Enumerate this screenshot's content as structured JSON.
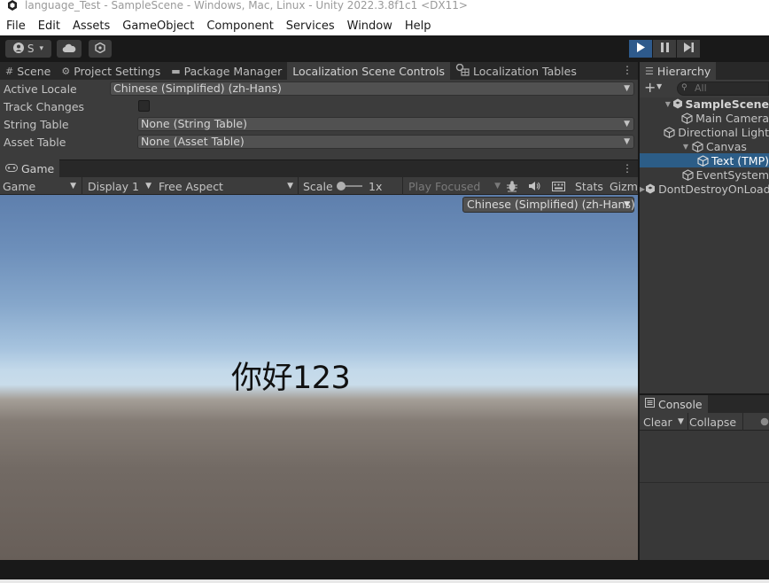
{
  "titlebar": {
    "title": "language_Test - SampleScene - Windows, Mac, Linux - Unity 2022.3.8f1c1 <DX11>"
  },
  "menubar": {
    "items": [
      "File",
      "Edit",
      "Assets",
      "GameObject",
      "Component",
      "Services",
      "Window",
      "Help"
    ]
  },
  "toolbar": {
    "account_label": "S",
    "account_caret": "▾"
  },
  "scene_panel": {
    "tabs": [
      {
        "label": "Scene",
        "icon": "grid-icon"
      },
      {
        "label": "Project Settings",
        "icon": "gear-icon"
      },
      {
        "label": "Package Manager",
        "icon": "package-icon"
      },
      {
        "label": "Localization Scene Controls",
        "icon": ""
      },
      {
        "label": "Localization Tables",
        "icon": "localization-table-icon"
      }
    ],
    "active_locale_label": "Active Locale",
    "active_locale_value": "Chinese (Simplified) (zh-Hans)",
    "track_changes_label": "Track Changes",
    "string_table_label": "String Table",
    "string_table_value": "None (String Table)",
    "asset_table_label": "Asset Table",
    "asset_table_value": "None (Asset Table)"
  },
  "game_panel": {
    "tab_label": "Game",
    "display_mode": "Game",
    "display": "Display 1",
    "aspect": "Free Aspect",
    "scale_label": "Scale",
    "scale_value": "1x",
    "play_focused": "Play Focused",
    "stats_label": "Stats",
    "gizmos_label": "Gizmos",
    "locale_popup": "Chinese (Simplified) (zh-Hans)",
    "scene_text": "你好123"
  },
  "hierarchy": {
    "tab_label": "Hierarchy",
    "search_placeholder": "All",
    "items": [
      {
        "label": "SampleScene"
      },
      {
        "label": "Main Camera"
      },
      {
        "label": "Directional Light"
      },
      {
        "label": "Canvas"
      },
      {
        "label": "Text (TMP)"
      },
      {
        "label": "EventSystem"
      },
      {
        "label": "DontDestroyOnLoad"
      }
    ]
  },
  "console": {
    "tab_label": "Console",
    "clear_label": "Clear",
    "collapse_label": "Collapse"
  },
  "colors": {
    "selection": "#2c5d87",
    "play_active": "#2e5a8c",
    "panel_bg": "#383838"
  }
}
